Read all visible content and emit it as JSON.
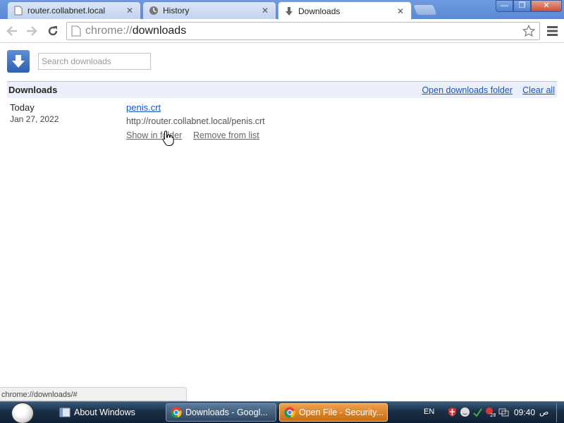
{
  "tabs": [
    {
      "title": "router.collabnet.local",
      "icon": "page-icon",
      "close": "✕"
    },
    {
      "title": "History",
      "icon": "clock-icon",
      "close": "✕"
    },
    {
      "title": "Downloads",
      "icon": "download-icon",
      "close": "✕"
    }
  ],
  "window_controls": {
    "minimize": "—",
    "maximize": "❐",
    "close": "✕"
  },
  "omnibox": {
    "scheme": "chrome://",
    "path": "downloads"
  },
  "search": {
    "placeholder": "Search downloads",
    "value": ""
  },
  "section": {
    "title": "Downloads",
    "open_folder_label": "Open downloads folder",
    "clear_all_label": "Clear all"
  },
  "download_item": {
    "date_label": "Today",
    "date": "Jan 27, 2022",
    "file_name": "penis.crt",
    "url": "http://router.collabnet.local/penis.crt",
    "show_in_folder": "Show in folder",
    "remove": "Remove from list"
  },
  "status_bar": {
    "text": "chrome://downloads/#"
  },
  "taskbar": {
    "tasks": [
      {
        "label": "About Windows",
        "icon": "window-icon"
      },
      {
        "label": "Downloads - Googl...",
        "icon": "chrome-icon"
      },
      {
        "label": "Open File - Security...",
        "icon": "chrome-icon"
      }
    ],
    "language": "EN",
    "clock": "09:40",
    "ampm": "ص"
  },
  "colors": {
    "link": "#1155cc",
    "section_bg": "#ebeff9",
    "accent": "#2f5fb0"
  }
}
